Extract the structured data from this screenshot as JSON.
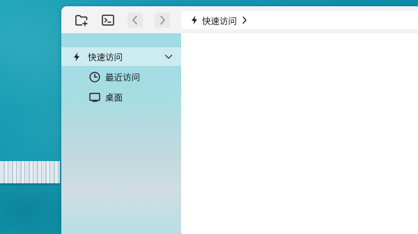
{
  "toolbar": {
    "new_folder_icon": "new-folder-icon",
    "terminal_icon": "terminal-icon",
    "back_icon": "chevron-left-icon",
    "forward_icon": "chevron-right-icon"
  },
  "address_bar": {
    "icon": "lightning-icon",
    "path": "快速访问",
    "separator_icon": "chevron-right-icon"
  },
  "sidebar": {
    "group": {
      "label": "快速访问",
      "icon": "lightning-icon",
      "expanded": true
    },
    "items": [
      {
        "label": "最近访问",
        "icon": "clock-icon"
      },
      {
        "label": "桌面",
        "icon": "monitor-icon"
      }
    ]
  },
  "colors": {
    "desktop_bg": "#0e93aa",
    "sidebar_bg": "#a6dde3",
    "toolbar_bg": "#f3f3f3",
    "content_bg": "#ffffff"
  }
}
